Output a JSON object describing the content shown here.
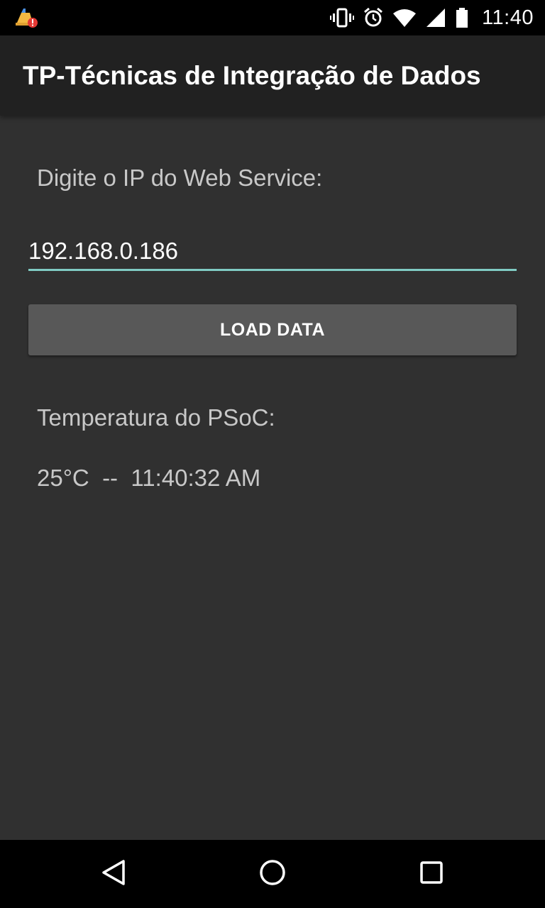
{
  "status_bar": {
    "time": "11:40",
    "notification_icon": "cleaner-app-alert-icon",
    "icons": [
      "vibrate-icon",
      "alarm-icon",
      "wifi-icon",
      "cell-signal-icon",
      "battery-icon"
    ]
  },
  "action_bar": {
    "title": "TP-Técnicas de Integração de Dados"
  },
  "form": {
    "ip_label": "Digite o IP do Web Service:",
    "ip_value": "192.168.0.186",
    "load_button_label": "LOAD DATA"
  },
  "result": {
    "temp_label": "Temperatura do PSoC:",
    "temp_value": "25°C  --  11:40:32 AM"
  },
  "nav_bar": {
    "buttons": [
      "back-icon",
      "home-icon",
      "recents-icon"
    ]
  },
  "colors": {
    "background": "#303030",
    "action_bar": "#212121",
    "input_accent": "#80cbc4",
    "button": "#585858"
  }
}
